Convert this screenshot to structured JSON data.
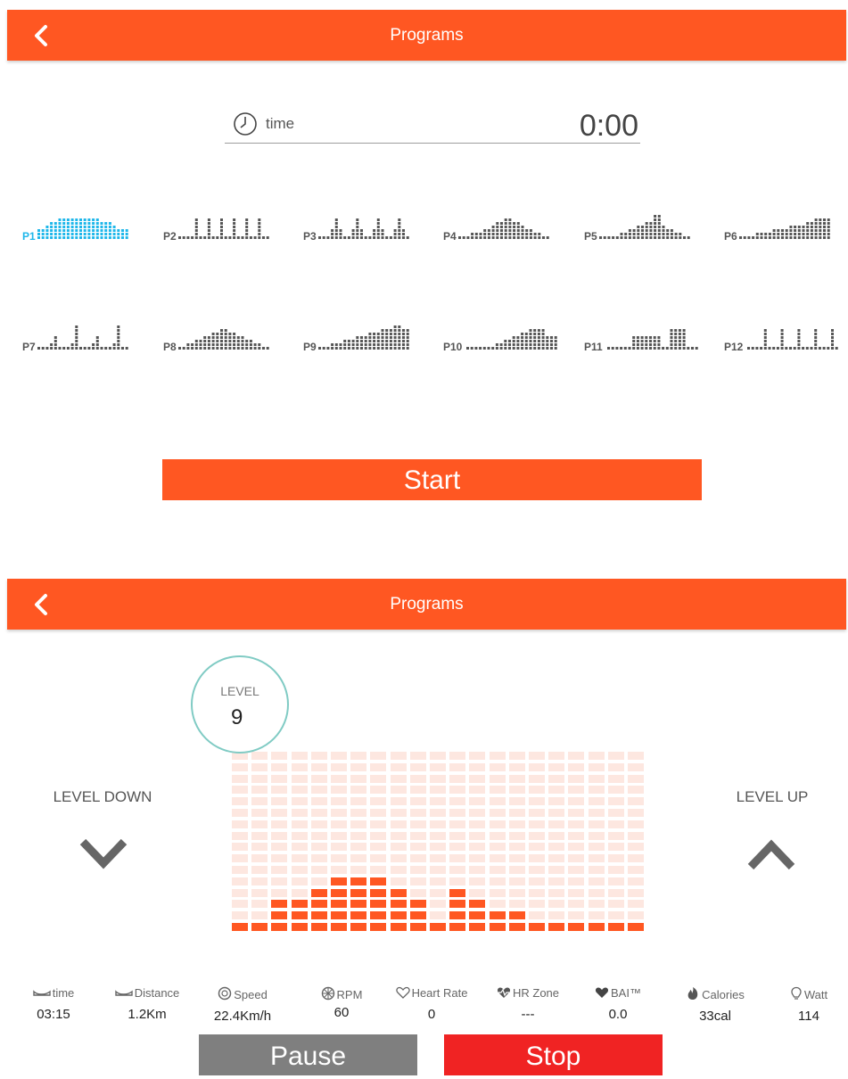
{
  "screen1": {
    "header": {
      "title": "Programs"
    },
    "time": {
      "label": "time",
      "value": "0:00"
    },
    "programs": [
      {
        "label": "P1",
        "selected": true,
        "profile": [
          3,
          3,
          4,
          5,
          5,
          6,
          6,
          6,
          6,
          6,
          6,
          6,
          6,
          6,
          6,
          5,
          5,
          5,
          4,
          3,
          3,
          3
        ]
      },
      {
        "label": "P2",
        "selected": false,
        "profile": [
          1,
          1,
          1,
          1,
          6,
          1,
          1,
          6,
          1,
          1,
          6,
          1,
          1,
          6,
          1,
          1,
          6,
          1,
          1,
          6,
          1,
          1
        ]
      },
      {
        "label": "P3",
        "selected": false,
        "profile": [
          1,
          1,
          1,
          3,
          6,
          3,
          1,
          1,
          3,
          6,
          3,
          1,
          1,
          3,
          6,
          3,
          1,
          1,
          3,
          6,
          3,
          1
        ]
      },
      {
        "label": "P4",
        "selected": false,
        "profile": [
          1,
          1,
          1,
          2,
          2,
          2,
          3,
          3,
          4,
          5,
          5,
          6,
          6,
          5,
          5,
          4,
          3,
          3,
          2,
          2,
          1,
          1
        ]
      },
      {
        "label": "P5",
        "selected": false,
        "profile": [
          1,
          1,
          1,
          1,
          1,
          2,
          2,
          3,
          3,
          4,
          4,
          5,
          5,
          7,
          7,
          4,
          3,
          3,
          2,
          2,
          1,
          1
        ]
      },
      {
        "label": "P6",
        "selected": false,
        "profile": [
          1,
          1,
          1,
          1,
          2,
          2,
          2,
          2,
          3,
          3,
          3,
          3,
          4,
          4,
          4,
          4,
          5,
          5,
          6,
          6,
          6,
          6
        ]
      },
      {
        "label": "P7",
        "selected": false,
        "profile": [
          1,
          1,
          1,
          2,
          4,
          1,
          1,
          1,
          2,
          7,
          1,
          1,
          1,
          2,
          4,
          1,
          1,
          1,
          2,
          7,
          1,
          1
        ]
      },
      {
        "label": "P8",
        "selected": false,
        "profile": [
          1,
          1,
          2,
          2,
          3,
          3,
          4,
          4,
          5,
          5,
          6,
          6,
          5,
          5,
          4,
          4,
          3,
          3,
          2,
          2,
          1,
          1
        ]
      },
      {
        "label": "P9",
        "selected": false,
        "profile": [
          1,
          1,
          1,
          2,
          2,
          2,
          3,
          3,
          3,
          4,
          4,
          4,
          5,
          5,
          5,
          6,
          6,
          6,
          7,
          7,
          6,
          6
        ]
      },
      {
        "label": "P10",
        "selected": false,
        "profile": [
          1,
          1,
          1,
          1,
          1,
          1,
          1,
          2,
          2,
          3,
          3,
          4,
          4,
          5,
          5,
          6,
          6,
          6,
          6,
          4,
          4,
          4
        ]
      },
      {
        "label": "P11",
        "selected": false,
        "profile": [
          1,
          1,
          1,
          1,
          1,
          1,
          4,
          4,
          4,
          4,
          4,
          4,
          4,
          1,
          1,
          6,
          6,
          6,
          6,
          1,
          1,
          1
        ]
      },
      {
        "label": "P12",
        "selected": false,
        "profile": [
          1,
          1,
          1,
          1,
          6,
          1,
          1,
          1,
          6,
          1,
          1,
          1,
          6,
          1,
          1,
          1,
          6,
          1,
          1,
          1,
          6,
          1
        ]
      }
    ],
    "start_label": "Start"
  },
  "screen2": {
    "header": {
      "title": "Programs"
    },
    "level": {
      "title": "LEVEL",
      "value": "9"
    },
    "level_down_label": "LEVEL DOWN",
    "level_up_label": "LEVEL UP",
    "profile_columns": [
      1,
      1,
      3,
      3,
      4,
      5,
      5,
      5,
      4,
      3,
      1,
      4,
      3,
      2,
      2,
      1,
      1,
      1,
      1,
      1,
      1
    ],
    "grid_rows": 16,
    "stats": [
      {
        "label": "time",
        "value": "03:15",
        "icon": "shoe-icon"
      },
      {
        "label": "Distance",
        "value": "1.2Km",
        "icon": "shoe-icon"
      },
      {
        "label": "Speed",
        "value": "22.4Km/h",
        "icon": "speed-icon"
      },
      {
        "label": "RPM",
        "value": "60",
        "icon": "wheel-icon"
      },
      {
        "label": "Heart Rate",
        "value": "0",
        "icon": "heart-icon"
      },
      {
        "label": "HR Zone",
        "value": "---",
        "icon": "heart-zone-icon"
      },
      {
        "label": "BAI™",
        "value": "0.0",
        "icon": "bai-heart-icon"
      },
      {
        "label": "Calories",
        "value": "33cal",
        "icon": "flame-icon"
      },
      {
        "label": "Watt",
        "value": "114",
        "icon": "bulb-icon"
      }
    ],
    "pause_label": "Pause",
    "stop_label": "Stop"
  },
  "colors": {
    "accent": "#ff5722",
    "selected": "#1fb7ea",
    "stop": "#f02323",
    "pause": "#7f7f7f",
    "cell_off": "#fde7e0",
    "circle": "#80cbc4"
  }
}
